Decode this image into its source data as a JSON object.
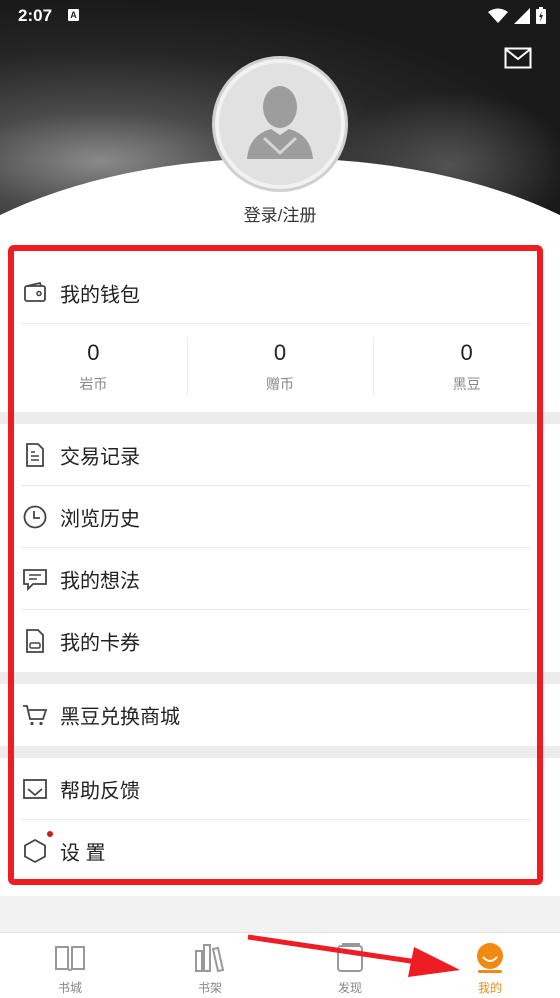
{
  "status_bar": {
    "time": "2:07",
    "notification_letter": "A"
  },
  "profile": {
    "login_label": "登录/注册"
  },
  "wallet": {
    "title": "我的钱包",
    "stats": [
      {
        "value": "0",
        "label": "岩币"
      },
      {
        "value": "0",
        "label": "赠币"
      },
      {
        "value": "0",
        "label": "黑豆"
      }
    ]
  },
  "menu_group_1": [
    {
      "label": "交易记录",
      "icon": "document-icon"
    },
    {
      "label": "浏览历史",
      "icon": "clock-icon"
    },
    {
      "label": "我的想法",
      "icon": "comment-icon"
    },
    {
      "label": "我的卡券",
      "icon": "card-icon"
    }
  ],
  "menu_group_2": [
    {
      "label": "黑豆兑换商城",
      "icon": "cart-icon"
    }
  ],
  "menu_group_3": [
    {
      "label": "帮助反馈",
      "icon": "feedback-mail-icon"
    },
    {
      "label": "设 置",
      "icon": "hexagon-settings-icon"
    }
  ],
  "tabs": [
    {
      "label": "书城",
      "icon": "book-icon",
      "active": false
    },
    {
      "label": "书架",
      "icon": "bookshelf-icon",
      "active": false
    },
    {
      "label": "发现",
      "icon": "discover-icon",
      "active": false
    },
    {
      "label": "我的",
      "icon": "profile-smile-icon",
      "active": true
    }
  ],
  "colors": {
    "accent": "#f08a12",
    "annotation_red": "#ee1d23",
    "badge": "#c81e1e"
  }
}
